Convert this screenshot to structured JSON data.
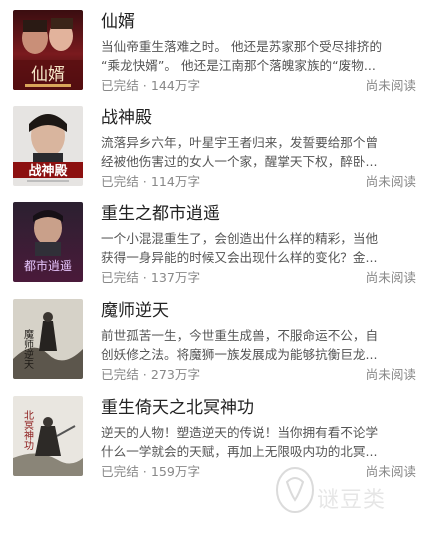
{
  "books": [
    {
      "title": "仙婿",
      "desc_line1": "当仙帝重生落难之时。 他还是苏家那个受尽排挤的",
      "desc_line2": "“乘龙快婿”。 他还是江南那个落魄家族的“废物...",
      "status": "已完结",
      "words": "144万字",
      "read_state": "尚未阅读",
      "cover_text": "仙婿"
    },
    {
      "title": "战神殿",
      "desc_line1": "流落异乡六年，叶星宇王者归来，发誓要给那个曾",
      "desc_line2": "经被他伤害过的女人一个家，醒掌天下权，醉卧...",
      "status": "已完结",
      "words": "114万字",
      "read_state": "尚未阅读",
      "cover_text": "战神殿"
    },
    {
      "title": "重生之都市逍遥",
      "desc_line1": "一个小混混重生了，会创造出什么样的精彩，当他",
      "desc_line2": "获得一身异能的时候又会出现什么样的变化？金...",
      "status": "已完结",
      "words": "137万字",
      "read_state": "尚未阅读",
      "cover_text": "都市逍遥"
    },
    {
      "title": "魔师逆天",
      "desc_line1": "前世孤苦一生，今世重生成兽，不服命运不公，自",
      "desc_line2": "创妖修之法。将魔狮一族发展成为能够抗衡巨龙...",
      "status": "已完结",
      "words": "273万字",
      "read_state": "尚未阅读",
      "cover_text": "魔师逆天"
    },
    {
      "title": "重生倚天之北冥神功",
      "desc_line1": "逆天的人物！塑造逆天的传说！当你拥有看不论学",
      "desc_line2": "什么一学就会的天赋，再加上无限吸内功的北冥...",
      "status": "已完结",
      "words": "159万字",
      "read_state": "尚未阅读",
      "cover_text": "北冥神功"
    }
  ],
  "separator": "·",
  "watermark": "谜豆类",
  "colors": {
    "title": "#222222",
    "desc": "#555555",
    "meta": "#888888",
    "background": "#ffffff"
  }
}
